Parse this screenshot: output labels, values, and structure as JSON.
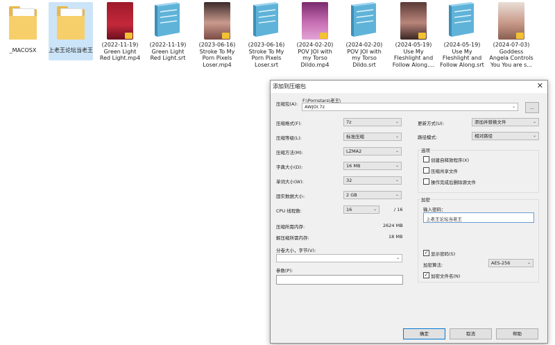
{
  "desktop": {
    "files": [
      {
        "label": "_MACOSX",
        "kind": "folder"
      },
      {
        "label": "上老王论坛当老王",
        "kind": "folder",
        "selected": true
      },
      {
        "label": "(2022-11-19) Green Light Red Light.mp4",
        "kind": "video"
      },
      {
        "label": "(2022-11-19) Green Light Red Light.srt",
        "kind": "notepad"
      },
      {
        "label": "(2023-06-16) Stroke To My Porn Pixels Loser.mp4",
        "kind": "video"
      },
      {
        "label": "(2023-06-16) Stroke To My Porn Pixels Loser.srt",
        "kind": "notepad"
      },
      {
        "label": "(2024-02-20) POV JOI with my Torso Dildo.mp4",
        "kind": "video"
      },
      {
        "label": "(2024-02-20) POV JOI with my Torso Dildo.srt",
        "kind": "notepad"
      },
      {
        "label": "(2024-05-19) Use My Fleshlight and Follow Along....",
        "kind": "video"
      },
      {
        "label": "(2024-05-19) Use My Fleshlight and Follow Along.srt",
        "kind": "notepad"
      },
      {
        "label": "(2024-07-03) Goddess Angela Controls You You are s...",
        "kind": "video"
      }
    ],
    "folder_colors": {
      "back": "#e8b84a",
      "front": "#f6cf6a"
    },
    "thumb_colors": [
      "#c4283a",
      "#c99a8d",
      "#c86fb4",
      "#b9857a",
      "#c99a8a"
    ]
  },
  "dialog": {
    "title": "添加到压缩包",
    "close_glyph": "✕",
    "archive": {
      "label": "压缩包(A):",
      "path": "F:\\Pornstars\\老王\\",
      "name": "AWJOI.7z",
      "browse": "..."
    },
    "format": {
      "label": "压缩格式(F):",
      "value": "7z"
    },
    "level": {
      "label": "压缩等级(L):",
      "value": "标准压缩"
    },
    "method": {
      "label": "压缩方法(M):",
      "value": "LZMA2"
    },
    "dict": {
      "label": "字典大小(D):",
      "value": "16 MB"
    },
    "word": {
      "label": "单词大小(W):",
      "value": "32"
    },
    "solid": {
      "label": "固实数据大小:",
      "value": "2 GB"
    },
    "threads": {
      "label": "CPU 线程数:",
      "value": "16",
      "max": "/ 16"
    },
    "mem_compress": {
      "label": "压缩所需内存:",
      "value": "2624 MB"
    },
    "mem_decompress": {
      "label": "解压缩所需内存:",
      "value": "18 MB"
    },
    "split": {
      "label": "分卷大小，字节(V):",
      "value": ""
    },
    "params": {
      "label": "参数(P):",
      "value": ""
    },
    "update": {
      "label": "更新方式(U):",
      "value": "添加并替换文件"
    },
    "pathmode": {
      "label": "路径模式:",
      "value": "相对路径"
    },
    "options": {
      "title": "选项",
      "sfx": {
        "label": "创建自释放程序(X)",
        "checked": false
      },
      "shared": {
        "label": "压缩共享文件",
        "checked": false
      },
      "delete": {
        "label": "操作完成后删除源文件",
        "checked": false
      }
    },
    "encryption": {
      "title": "加密",
      "pwd_label": "输入密码：",
      "password": "上老王论坛当老王",
      "show_pwd": {
        "label": "显示密码(S)",
        "checked": true
      },
      "algo_label": "加密算法:",
      "algo": "AES-256",
      "encrypt_names": {
        "label": "加密文件名(N)",
        "checked": true
      }
    },
    "buttons": {
      "ok": "确定",
      "cancel": "取消",
      "help": "帮助"
    },
    "check_glyph": "✓",
    "arrow_glyph": "⌄"
  }
}
